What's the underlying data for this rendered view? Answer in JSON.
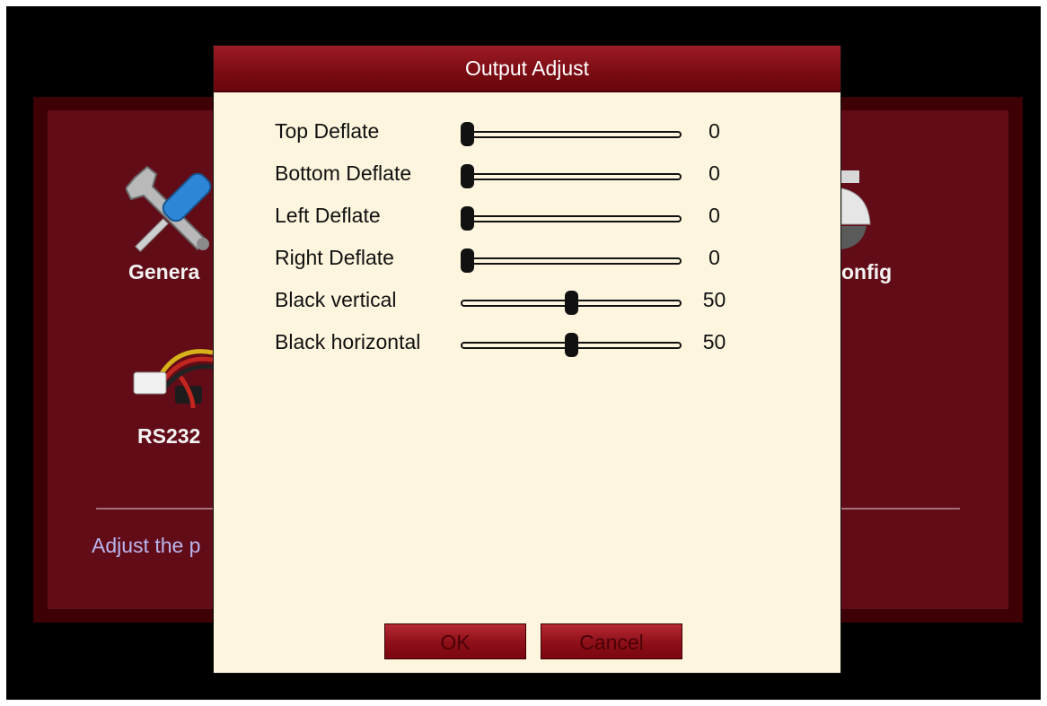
{
  "background_menu": {
    "tiles": [
      {
        "label": "Genera",
        "icon": "wrench-screwdriver-icon"
      },
      {
        "label": "onfig",
        "icon": "camera-dome-icon"
      },
      {
        "label": "RS232",
        "icon": "cable-connector-icon"
      }
    ],
    "hint": "Adjust the p"
  },
  "dialog": {
    "title": "Output Adjust",
    "sliders": [
      {
        "label": "Top Deflate",
        "value": "0",
        "fraction": 0.0
      },
      {
        "label": "Bottom Deflate",
        "value": "0",
        "fraction": 0.0
      },
      {
        "label": "Left Deflate",
        "value": "0",
        "fraction": 0.0
      },
      {
        "label": "Right Deflate",
        "value": "0",
        "fraction": 0.0
      },
      {
        "label": "Black vertical",
        "value": "50",
        "fraction": 0.5
      },
      {
        "label": "Black horizontal",
        "value": "50",
        "fraction": 0.5
      }
    ],
    "ok_label": "OK",
    "cancel_label": "Cancel"
  },
  "colors": {
    "title_bar": "#7a0b12",
    "dialog_bg": "#fdf5dd",
    "menu_bg": "#620c17",
    "hint_text": "#b9b6f0"
  }
}
